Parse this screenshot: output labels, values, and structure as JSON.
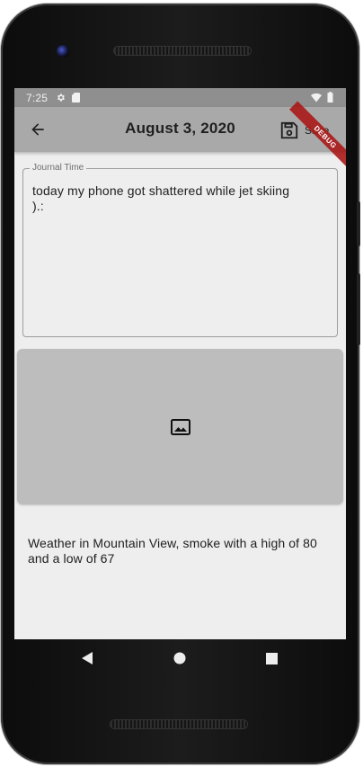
{
  "status_bar": {
    "time": "7:25",
    "icons": [
      "gear-icon",
      "sd-card-icon",
      "wifi-icon",
      "battery-icon"
    ]
  },
  "app_bar": {
    "back_icon": "arrow-back-icon",
    "title": "August 3, 2020",
    "save_icon": "save-icon",
    "save_label": "Save",
    "debug_banner": "DEBUG"
  },
  "journal": {
    "label": "Journal Time",
    "text": "today my phone got shattered while jet skiing\n).:"
  },
  "image_placeholder": {
    "icon": "image-icon"
  },
  "weather": {
    "text": "Weather in Mountain View, smoke with a high of 80 and a low of 67"
  },
  "nav_bar": {
    "icons": [
      "back-triangle-icon",
      "home-circle-icon",
      "recents-square-icon"
    ]
  },
  "colors": {
    "app_bar": "#a9a9a9",
    "status_bar": "#8f8f8f",
    "background": "#eeeeee",
    "image_card": "#bdbdbd",
    "debug_banner": "#aa1414"
  }
}
